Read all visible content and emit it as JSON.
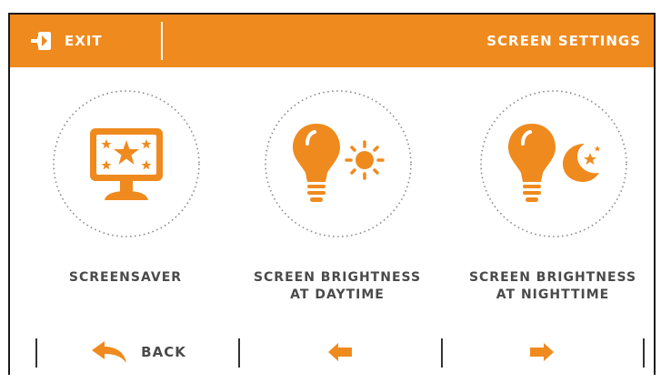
{
  "header": {
    "exit_label": "EXIT",
    "title": "SCREEN SETTINGS",
    "exit_icon": "exit-door-icon"
  },
  "tiles": [
    {
      "label_line1": "SCREENSAVER",
      "label_line2": "",
      "icon": "monitor-stars-icon"
    },
    {
      "label_line1": "SCREEN BRIGHTNESS",
      "label_line2": "AT DAYTIME",
      "icon": "bulb-sun-icon"
    },
    {
      "label_line1": "SCREEN BRIGHTNESS",
      "label_line2": "AT NIGHTTIME",
      "icon": "bulb-moon-icon"
    }
  ],
  "footer": {
    "back_label": "BACK",
    "prev_icon": "arrow-left-icon",
    "next_icon": "arrow-right-icon"
  },
  "colors": {
    "accent": "#ef8a1e",
    "text": "#4a4a4a",
    "background": "#ffffff"
  }
}
